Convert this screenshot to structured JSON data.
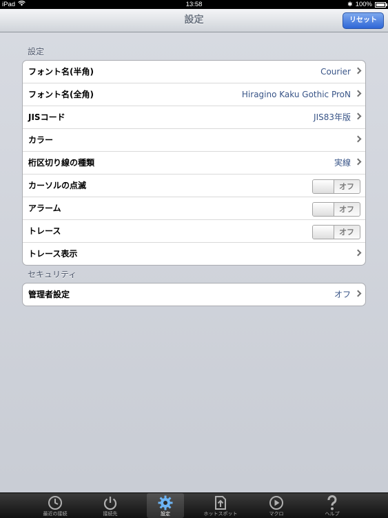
{
  "status_bar": {
    "device": "iPad",
    "time": "13:58",
    "battery": "100%"
  },
  "nav": {
    "title": "設定",
    "reset_label": "リセット"
  },
  "sections": [
    {
      "header": "設定",
      "rows": [
        {
          "label": "フォント名(半角)",
          "value": "Courier"
        },
        {
          "label": "フォント名(全角)",
          "value": "Hiragino Kaku Gothic ProN"
        },
        {
          "label": "JISコード",
          "value": "JIS83年版"
        },
        {
          "label": "カラー",
          "value": ""
        },
        {
          "label": "桁区切り線の種類",
          "value": "実線"
        },
        {
          "label": "カーソルの点滅",
          "toggle": "オフ"
        },
        {
          "label": "アラーム",
          "toggle": "オフ"
        },
        {
          "label": "トレース",
          "toggle": "オフ"
        },
        {
          "label": "トレース表示",
          "value": ""
        }
      ]
    },
    {
      "header": "セキュリティ",
      "rows": [
        {
          "label": "管理者設定",
          "value": "オフ"
        }
      ]
    }
  ],
  "tabs": [
    {
      "label": "最近の接続",
      "icon": "clock-icon"
    },
    {
      "label": "接続先",
      "icon": "power-icon"
    },
    {
      "label": "設定",
      "icon": "gear-icon",
      "selected": true
    },
    {
      "label": "ホットスポット",
      "icon": "upload-icon"
    },
    {
      "label": "マクロ",
      "icon": "play-icon"
    },
    {
      "label": "ヘルプ",
      "icon": "help-icon"
    }
  ],
  "colors": {
    "accent": "#2e66d6",
    "value_text": "#385487",
    "tab_bar": "#1e1e1e"
  }
}
